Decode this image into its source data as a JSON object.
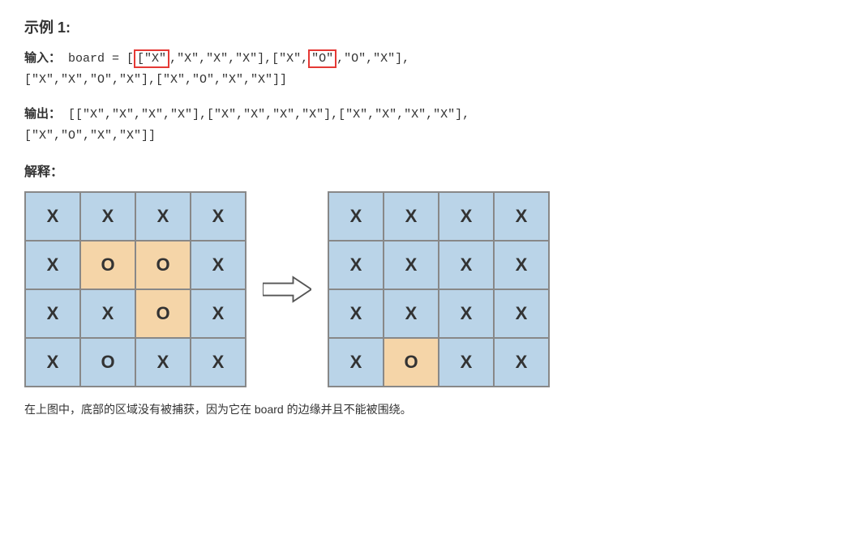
{
  "section": {
    "title": "示例 1:",
    "input_label": "输入：",
    "input_code": "board = [[\"X\",\"X\",\"X\",\"X\"],[\"X\",",
    "input_highlight1": "[\"X\"",
    "input_code2": ",\"X\",\"X\",\"X\"],[\"X\",",
    "input_highlight2": "\"O\"",
    "input_code3": ",\"O\",\"X\"],[\"X\",\"X\",\"O\",\"X\"],[\"X\",\"O\",\"X\",\"X\"]]",
    "input_full_line1": "board = [[\"X\",\"X\",\"X\",\"X\"],[\"X\",\"O\",\"O\",\"X\"],",
    "input_full_line2": "[\"X\",\"X\",\"O\",\"X\"],[\"X\",\"O\",\"X\",\"X\"]]",
    "output_label": "输出：",
    "output_line1": "[[\"X\",\"X\",\"X\",\"X\"],[\"X\",\"X\",\"X\",\"X\"],[\"X\",\"X\",\"X\",\"X\"],",
    "output_line2": "[\"X\",\"O\",\"X\",\"X\"]]",
    "explain_label": "解释：",
    "caption": "在上图中，底部的区域没有被捕获，因为它在 board 的边缘并且不能被围绕。",
    "grid_left": [
      [
        "X",
        "X",
        "X",
        "X"
      ],
      [
        "X",
        "O",
        "O",
        "X"
      ],
      [
        "X",
        "X",
        "O",
        "X"
      ],
      [
        "X",
        "O",
        "X",
        "X"
      ]
    ],
    "grid_right": [
      [
        "X",
        "X",
        "X",
        "X"
      ],
      [
        "X",
        "X",
        "X",
        "X"
      ],
      [
        "X",
        "X",
        "X",
        "X"
      ],
      [
        "X",
        "O",
        "X",
        "X"
      ]
    ],
    "left_orange_cells": [
      [
        1,
        1
      ],
      [
        1,
        2
      ],
      [
        2,
        2
      ]
    ],
    "right_orange_cells": [
      [
        3,
        1
      ]
    ]
  }
}
